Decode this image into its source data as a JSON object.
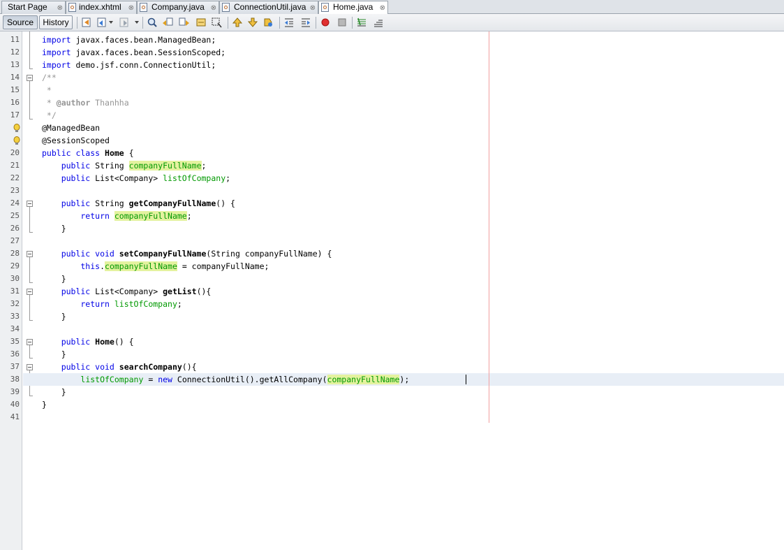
{
  "tabs": [
    {
      "label": "Start Page",
      "has_icon": false
    },
    {
      "label": "index.xhtml",
      "has_icon": true
    },
    {
      "label": "Company.java",
      "has_icon": true
    },
    {
      "label": "ConnectionUtil.java",
      "has_icon": true
    },
    {
      "label": "Home.java",
      "has_icon": true,
      "active": true
    }
  ],
  "tab_close_glyph": "⊗",
  "toolbar": {
    "source_label": "Source",
    "history_label": "History"
  },
  "line_numbers": [
    "11",
    "12",
    "13",
    "14",
    "15",
    "16",
    "17",
    "",
    "",
    "20",
    "21",
    "22",
    "23",
    "24",
    "25",
    "26",
    "27",
    "28",
    "29",
    "30",
    "31",
    "32",
    "33",
    "34",
    "35",
    "36",
    "37",
    "38",
    "39",
    "40",
    "41"
  ],
  "code_lines": [
    [
      {
        "t": "import",
        "c": "kw"
      },
      {
        "t": " javax.faces.bean.ManagedBean;"
      }
    ],
    [
      {
        "t": "import",
        "c": "kw"
      },
      {
        "t": " javax.faces.bean.SessionScoped;"
      }
    ],
    [
      {
        "t": "import",
        "c": "kw"
      },
      {
        "t": " demo.jsf.conn.ConnectionUtil;"
      }
    ],
    [
      {
        "t": "/**",
        "c": "cm"
      }
    ],
    [
      {
        "t": " *",
        "c": "cm"
      }
    ],
    [
      {
        "t": " * ",
        "c": "cm"
      },
      {
        "t": "@author",
        "c": "cm bold"
      },
      {
        "t": " Thanhha",
        "c": "cm"
      }
    ],
    [
      {
        "t": " */",
        "c": "cm"
      }
    ],
    [
      {
        "t": "@ManagedBean"
      }
    ],
    [
      {
        "t": "@SessionScoped"
      }
    ],
    [
      {
        "t": "public class ",
        "c": "kw"
      },
      {
        "t": "Home",
        "c": "bold"
      },
      {
        "t": " {"
      }
    ],
    [
      {
        "t": "    public ",
        "c": "kw"
      },
      {
        "t": "String "
      },
      {
        "t": "companyFullName",
        "c": "hl"
      },
      {
        "t": ";"
      }
    ],
    [
      {
        "t": "    public ",
        "c": "kw"
      },
      {
        "t": "List<Company> "
      },
      {
        "t": "listOfCompany",
        "c": "fld"
      },
      {
        "t": ";"
      }
    ],
    [
      {
        "t": ""
      }
    ],
    [
      {
        "t": "    public ",
        "c": "kw"
      },
      {
        "t": "String "
      },
      {
        "t": "getCompanyFullName",
        "c": "bold"
      },
      {
        "t": "() {"
      }
    ],
    [
      {
        "t": "        return ",
        "c": "kw"
      },
      {
        "t": "companyFullName",
        "c": "hl"
      },
      {
        "t": ";"
      }
    ],
    [
      {
        "t": "    }"
      }
    ],
    [
      {
        "t": ""
      }
    ],
    [
      {
        "t": "    public void ",
        "c": "kw"
      },
      {
        "t": "setCompanyFullName",
        "c": "bold"
      },
      {
        "t": "(String companyFullName) {"
      }
    ],
    [
      {
        "t": "        this",
        "c": "kw"
      },
      {
        "t": "."
      },
      {
        "t": "companyFullName",
        "c": "hl"
      },
      {
        "t": " = companyFullName;"
      }
    ],
    [
      {
        "t": "    }"
      }
    ],
    [
      {
        "t": "    public ",
        "c": "kw"
      },
      {
        "t": "List<Company> "
      },
      {
        "t": "getList",
        "c": "bold"
      },
      {
        "t": "(){"
      }
    ],
    [
      {
        "t": "        return ",
        "c": "kw"
      },
      {
        "t": "listOfCompany",
        "c": "fld"
      },
      {
        "t": ";"
      }
    ],
    [
      {
        "t": "    }"
      }
    ],
    [
      {
        "t": ""
      }
    ],
    [
      {
        "t": "    public ",
        "c": "kw"
      },
      {
        "t": "Home",
        "c": "bold"
      },
      {
        "t": "() {"
      }
    ],
    [
      {
        "t": "    }"
      }
    ],
    [
      {
        "t": "    public void ",
        "c": "kw"
      },
      {
        "t": "searchCompany",
        "c": "bold"
      },
      {
        "t": "(){"
      }
    ],
    [
      {
        "t": "        "
      },
      {
        "t": "listOfCompany",
        "c": "fld"
      },
      {
        "t": " = "
      },
      {
        "t": "new",
        "c": "kw"
      },
      {
        "t": " ConnectionUtil().getAllCompany("
      },
      {
        "t": "companyFullName",
        "c": "hl"
      },
      {
        "t": ");"
      }
    ],
    [
      {
        "t": "    }"
      }
    ],
    [
      {
        "t": "}"
      }
    ],
    [
      {
        "t": ""
      }
    ]
  ]
}
